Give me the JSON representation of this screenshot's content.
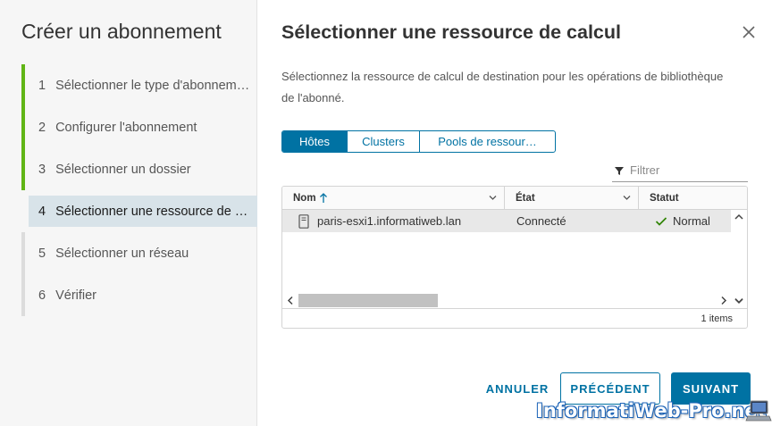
{
  "sidebar": {
    "title": "Créer un abonnement",
    "steps": [
      {
        "num": "1",
        "label": "Sélectionner le type d'abonnem…"
      },
      {
        "num": "2",
        "label": "Configurer l'abonnement"
      },
      {
        "num": "3",
        "label": "Sélectionner un dossier"
      },
      {
        "num": "4",
        "label": "Sélectionner une ressource de …"
      },
      {
        "num": "5",
        "label": "Sélectionner un réseau"
      },
      {
        "num": "6",
        "label": "Vérifier"
      }
    ]
  },
  "main": {
    "title": "Sélectionner une ressource de calcul",
    "description": "Sélectionnez la ressource de calcul de destination pour les opérations de bibliothèque de l'abonné.",
    "tabs": [
      "Hôtes",
      "Clusters",
      "Pools de ressour…"
    ],
    "filter_placeholder": "Filtrer",
    "grid": {
      "columns": [
        "Nom",
        "État",
        "Statut"
      ],
      "rows": [
        {
          "name": "paris-esxi1.informatiweb.lan",
          "state": "Connecté",
          "status": "Normal"
        }
      ],
      "footer": "1 items"
    },
    "buttons": {
      "cancel": "ANNULER",
      "back": "PRÉCÉDENT",
      "next": "SUIVANT"
    }
  },
  "watermark": "InformatiWeb-Pro.net",
  "colors": {
    "accent": "#0072a3",
    "done_bar": "#60b515",
    "active_step_bg": "#d8e3e9",
    "status_ok": "#2f8400"
  },
  "icons": [
    "close-icon",
    "filter-icon",
    "sort-up-icon",
    "chevron-down-icon",
    "host-icon",
    "check-icon",
    "scroll-arrow-icon"
  ]
}
